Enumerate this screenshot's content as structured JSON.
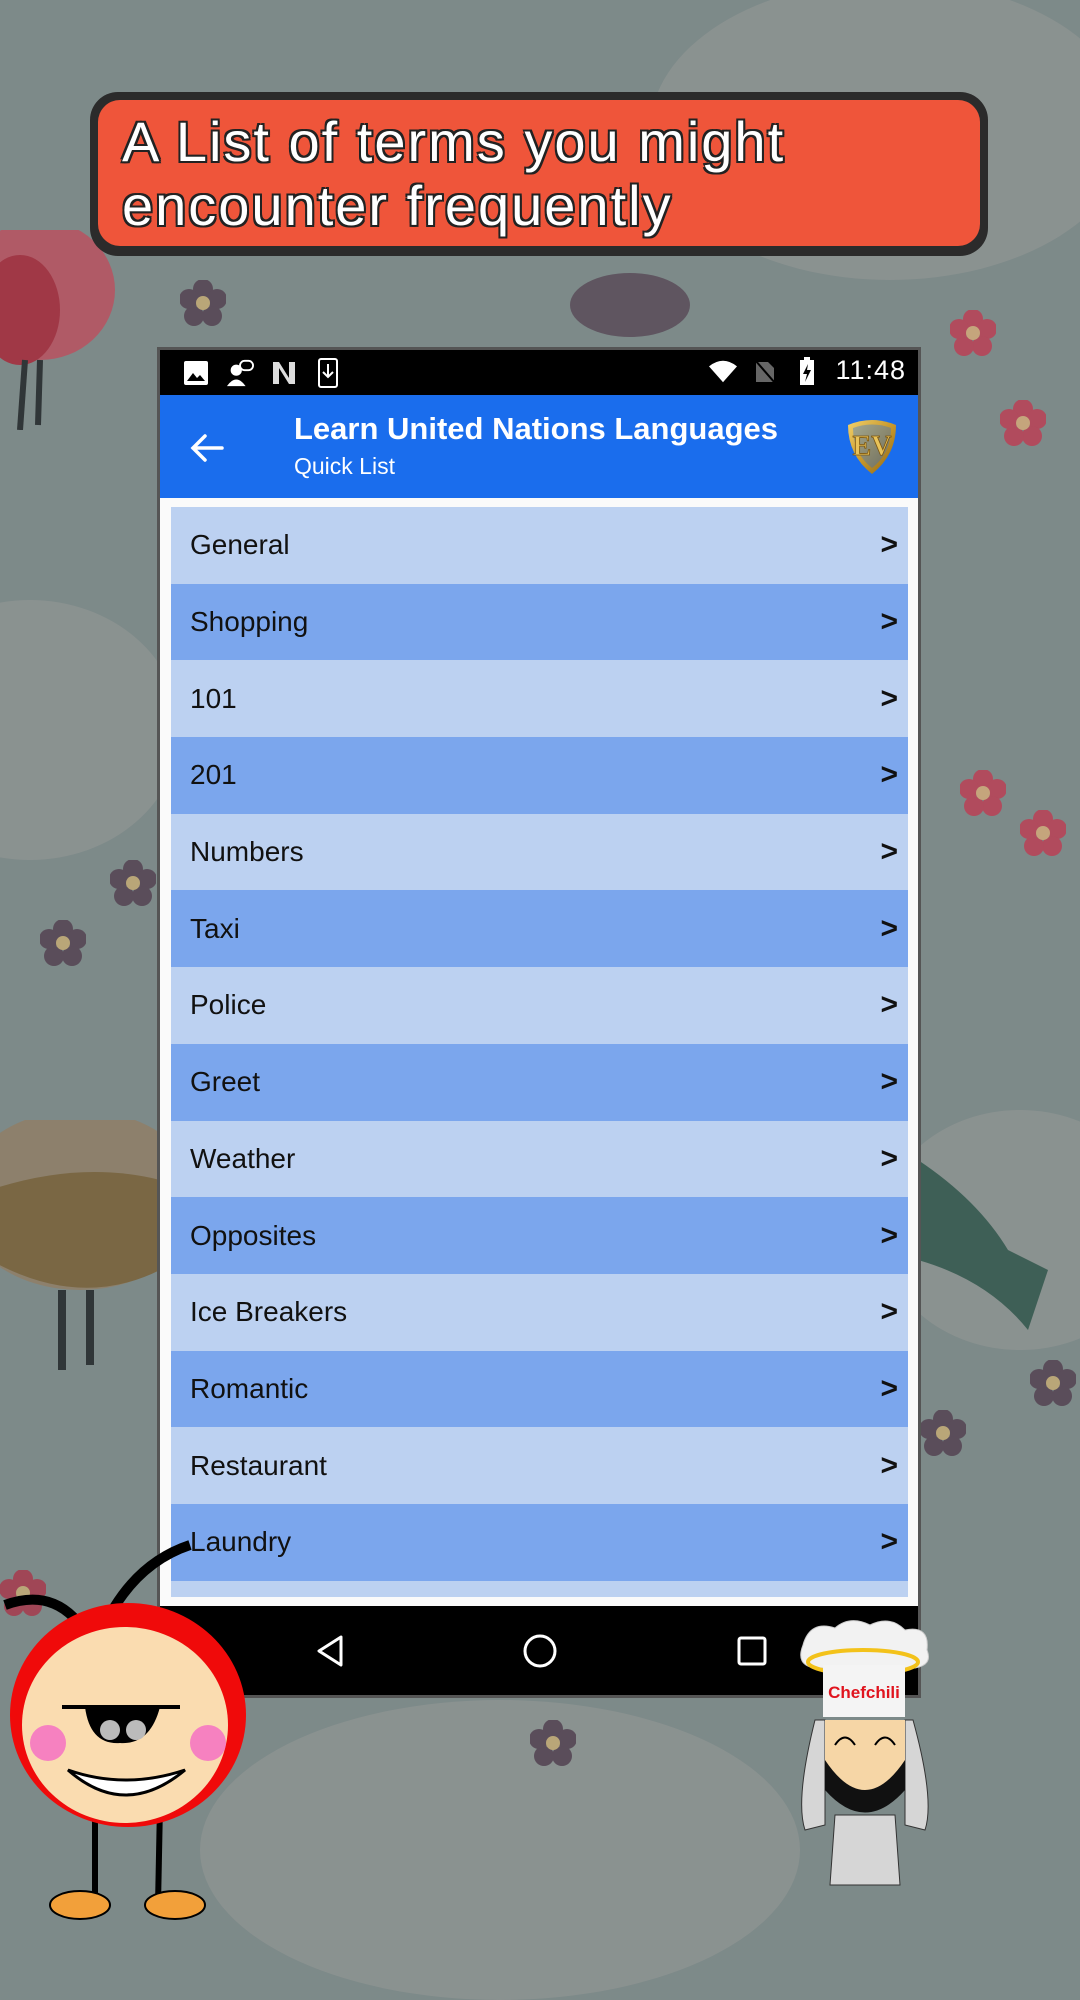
{
  "banner": {
    "text": "A List of terms you might\nencounter frequently"
  },
  "status_bar": {
    "left_icons": [
      "image-icon",
      "speech-person-icon",
      "n-logo-icon",
      "download-icon"
    ],
    "right_icons": [
      "wifi-icon",
      "no-sim-icon",
      "battery-charging-icon"
    ],
    "time": "11:48"
  },
  "app_bar": {
    "back_icon": "arrow-left-icon",
    "title": "Learn United Nations Languages",
    "subtitle": "Quick List",
    "logo_text": "EV"
  },
  "list": {
    "chevron": ">",
    "items": [
      {
        "label": "General"
      },
      {
        "label": "Shopping"
      },
      {
        "label": "101"
      },
      {
        "label": "201"
      },
      {
        "label": "Numbers"
      },
      {
        "label": "Taxi"
      },
      {
        "label": "Police"
      },
      {
        "label": "Greet"
      },
      {
        "label": "Weather"
      },
      {
        "label": "Opposites"
      },
      {
        "label": "Ice Breakers"
      },
      {
        "label": "Romantic"
      },
      {
        "label": "Restaurant"
      },
      {
        "label": "Laundry"
      },
      {
        "label": ""
      }
    ]
  },
  "nav_bar": {
    "back": "triangle-back-icon",
    "home": "circle-home-icon",
    "recents": "square-recents-icon"
  },
  "mascots": {
    "chef_label": "Chefchili"
  },
  "colors": {
    "background": "#7d8a89",
    "banner": "#ef553a",
    "app_bar": "#1a6ded",
    "row_light": "#bcd1f1",
    "row_dark": "#7ba6ed"
  }
}
